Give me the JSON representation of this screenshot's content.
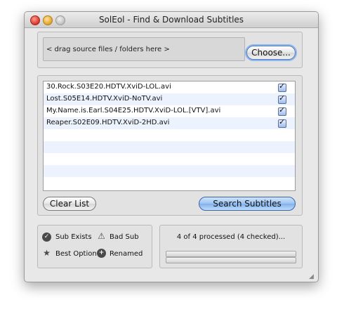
{
  "window": {
    "title": "SolEol - Find & Download Subtitles"
  },
  "source": {
    "drop_text": "< drag source files / folders here >",
    "choose_label": "Choose..."
  },
  "files": [
    {
      "name": "30.Rock.S03E20.HDTV.XviD-LOL.avi",
      "checked": true
    },
    {
      "name": "Lost.S05E14.HDTV.XviD-NoTV.avi",
      "checked": true
    },
    {
      "name": "My.Name.is.Earl.S04E25.HDTV.XviD-LOL.[VTV].avi",
      "checked": true
    },
    {
      "name": "Reaper.S02E09.HDTV.XviD-2HD.avi",
      "checked": true
    }
  ],
  "actions": {
    "clear_label": "Clear List",
    "search_label": "Search Subtitles"
  },
  "legend": {
    "sub_exists": "Sub Exists",
    "bad_sub": "Bad Sub",
    "best_option": "Best Option",
    "renamed": "Renamed"
  },
  "status": {
    "text": "4 of 4 processed (4 checked)...",
    "bar1_progress": 0,
    "bar2_progress": 0
  },
  "colors": {
    "accent": "#7fb0ee",
    "row_alt": "#edf3fe"
  }
}
